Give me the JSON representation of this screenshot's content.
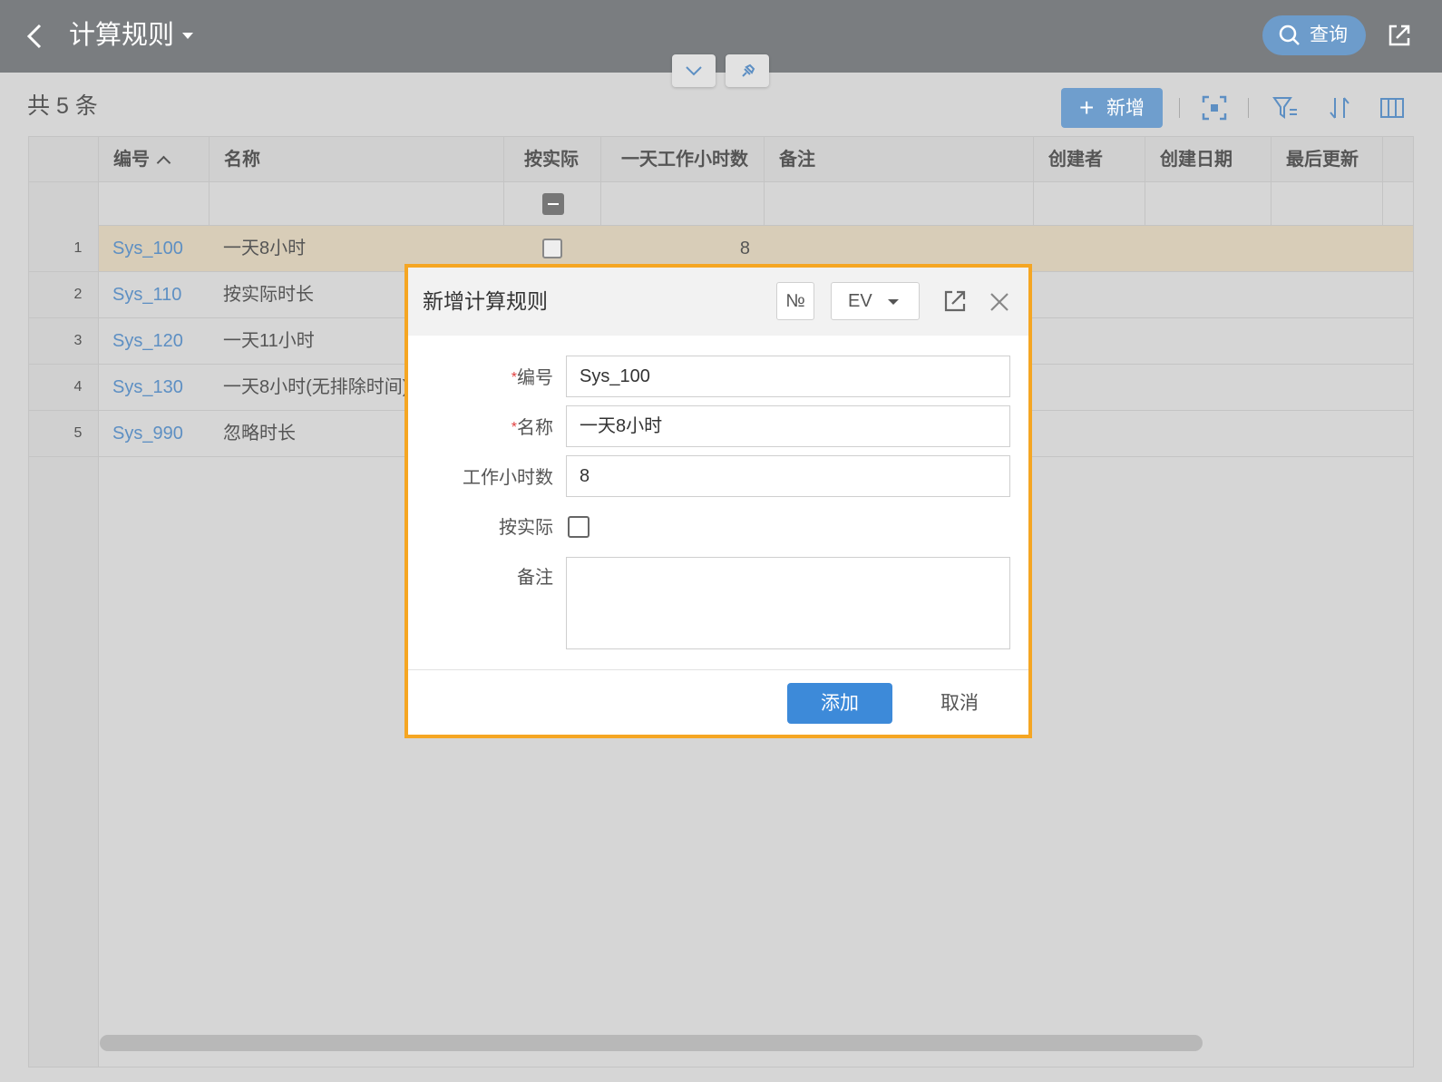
{
  "header": {
    "title": "计算规则",
    "query_label": "查询"
  },
  "toolbar": {
    "count_label": "共 5 条",
    "add_label": "新增"
  },
  "grid": {
    "columns": [
      {
        "label": "编号"
      },
      {
        "label": "名称"
      },
      {
        "label": "按实际"
      },
      {
        "label": "一天工作小时数"
      },
      {
        "label": "备注"
      },
      {
        "label": "创建者"
      },
      {
        "label": "创建日期"
      },
      {
        "label": "最后更新"
      }
    ],
    "rows": [
      {
        "index": "1",
        "code": "Sys_100",
        "name": "一天8小时",
        "hours": "8",
        "selected": true
      },
      {
        "index": "2",
        "code": "Sys_110",
        "name": "按实际时长",
        "hours": ""
      },
      {
        "index": "3",
        "code": "Sys_120",
        "name": "一天11小时",
        "hours": ""
      },
      {
        "index": "4",
        "code": "Sys_130",
        "name": "一天8小时(无排除时间)",
        "hours": ""
      },
      {
        "index": "5",
        "code": "Sys_990",
        "name": "忽略时长",
        "hours": ""
      }
    ]
  },
  "dialog": {
    "title": "新增计算规则",
    "no_button": "№",
    "ev_label": "EV",
    "fields": {
      "code_label": "编号",
      "code_value": "Sys_100",
      "name_label": "名称",
      "name_value": "一天8小时",
      "hours_label": "工作小时数",
      "hours_value": "8",
      "actual_label": "按实际",
      "note_label": "备注",
      "required_mark": "*"
    },
    "add_button": "添加",
    "cancel_button": "取消"
  },
  "colors": {
    "topbar": "#7a7d80",
    "accent": "#3d8ad9",
    "highlight_border": "#f5a623",
    "link": "#5d8fc3",
    "selected_row": "#d8cdb8"
  }
}
